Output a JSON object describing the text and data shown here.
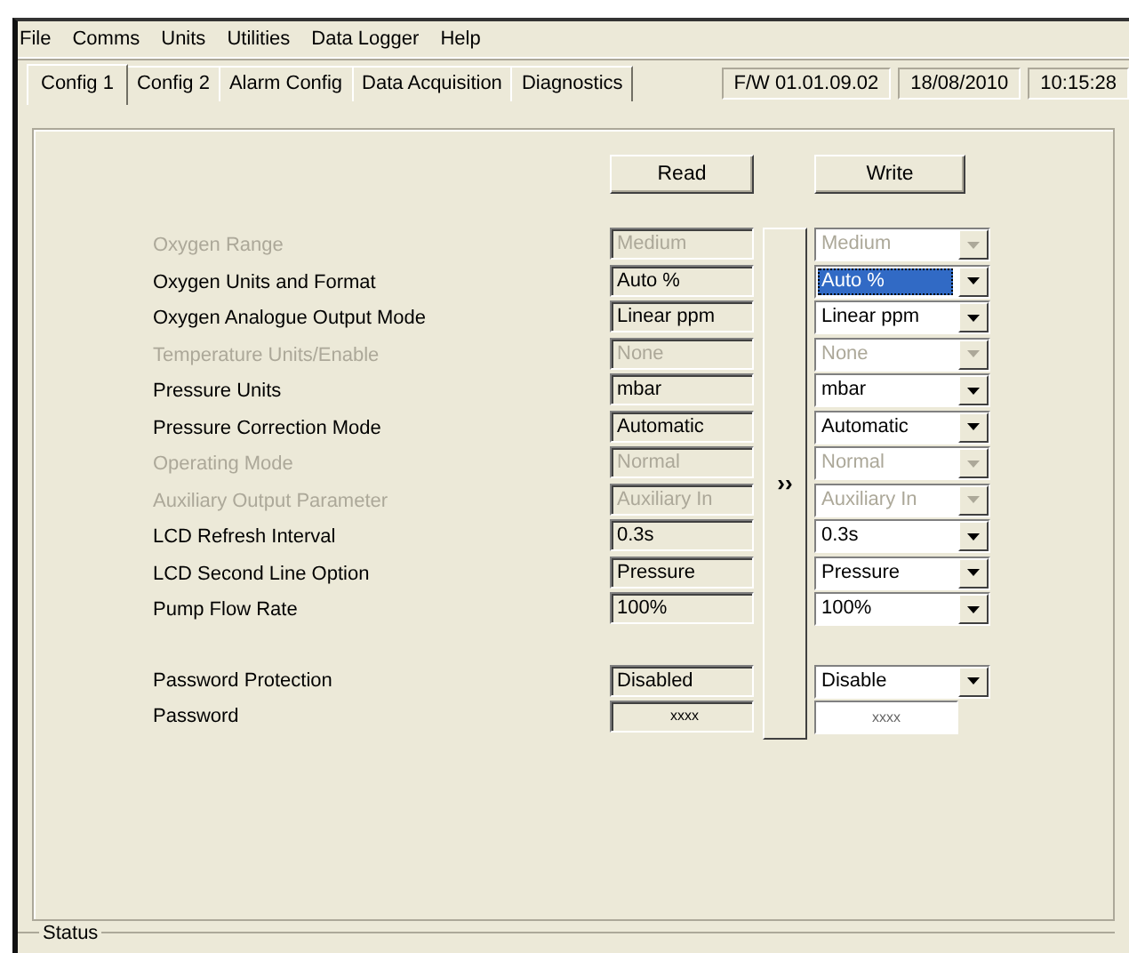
{
  "menu": [
    "File",
    "Comms",
    "Units",
    "Utilities",
    "Data Logger",
    "Help"
  ],
  "tabs": [
    {
      "label": "Config 1",
      "selected": true
    },
    {
      "label": "Config 2",
      "selected": false
    },
    {
      "label": "Alarm Config",
      "selected": false
    },
    {
      "label": "Data Acquisition",
      "selected": false
    },
    {
      "label": "Diagnostics",
      "selected": false
    }
  ],
  "status_fields": [
    "F/W 01.01.09.02",
    "18/08/2010",
    "10:15:28"
  ],
  "read_button": "Read",
  "write_button": "Write",
  "transfer_button": "››",
  "settings": [
    {
      "label": "Oxygen Range",
      "disabled": true,
      "read_value": "Medium",
      "kind": "select",
      "write_value": "Medium",
      "selected": false
    },
    {
      "label": "Oxygen Units and Format",
      "disabled": false,
      "read_value": "Auto %",
      "kind": "select",
      "write_value": "Auto %",
      "selected": true
    },
    {
      "label": "Oxygen Analogue Output Mode",
      "disabled": false,
      "read_value": "Linear ppm",
      "kind": "select",
      "write_value": "Linear ppm",
      "selected": false
    },
    {
      "label": "Temperature Units/Enable",
      "disabled": true,
      "read_value": "None",
      "kind": "select",
      "write_value": "None",
      "selected": false
    },
    {
      "label": "Pressure Units",
      "disabled": false,
      "read_value": "mbar",
      "kind": "select",
      "write_value": "mbar",
      "selected": false
    },
    {
      "label": "Pressure Correction Mode",
      "disabled": false,
      "read_value": "Automatic",
      "kind": "select",
      "write_value": "Automatic",
      "selected": false
    },
    {
      "label": "Operating Mode",
      "disabled": true,
      "read_value": "Normal",
      "kind": "select",
      "write_value": "Normal",
      "selected": false
    },
    {
      "label": "Auxiliary Output Parameter",
      "disabled": true,
      "read_value": "Auxiliary In",
      "kind": "select",
      "write_value": "Auxiliary In",
      "selected": false
    },
    {
      "label": "LCD Refresh Interval",
      "disabled": false,
      "read_value": "0.3s",
      "kind": "select",
      "write_value": "0.3s",
      "selected": false
    },
    {
      "label": "LCD Second Line Option",
      "disabled": false,
      "read_value": "Pressure",
      "kind": "select",
      "write_value": "Pressure",
      "selected": false
    },
    {
      "label": "Pump Flow Rate",
      "disabled": false,
      "read_value": "100%",
      "kind": "select",
      "write_value": "100%",
      "selected": false
    }
  ],
  "password_settings": [
    {
      "label": "Password Protection",
      "disabled": false,
      "read_value": "Disabled",
      "kind": "select",
      "write_value": "Disable"
    },
    {
      "label": "Password",
      "disabled": false,
      "read_value": "xxxx",
      "kind": "text",
      "write_value": "xxxx"
    }
  ],
  "status_group": {
    "title": "Status"
  }
}
